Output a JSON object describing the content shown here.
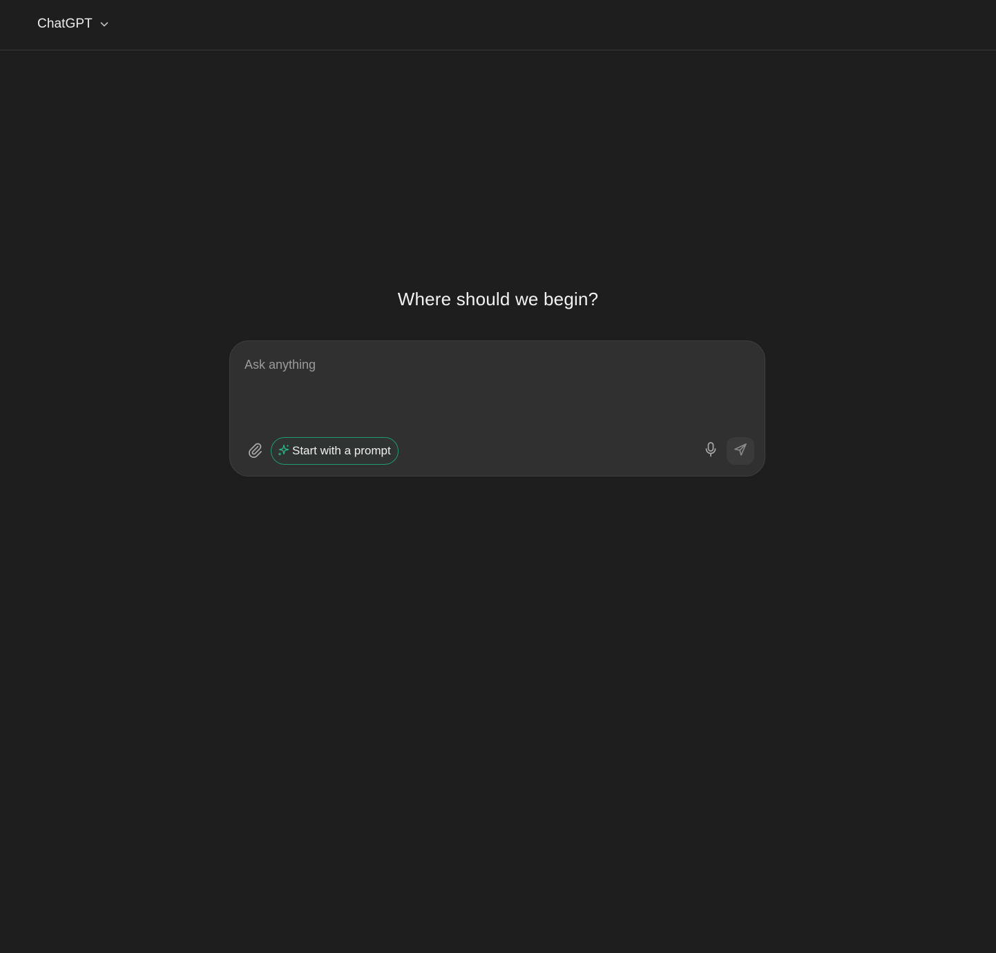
{
  "header": {
    "model_name": "ChatGPT",
    "dropdown_icon": "chevron-down-icon"
  },
  "main": {
    "headline": "Where should we begin?"
  },
  "composer": {
    "placeholder": "Ask anything",
    "value": "",
    "attach_icon": "paperclip-icon",
    "prompt_chip": {
      "label": "Start with a prompt",
      "icon": "sparkle-icon"
    },
    "mic_icon": "microphone-icon",
    "send_icon": "send-icon"
  },
  "colors": {
    "background": "#1e1e1e",
    "composer_background": "#303030",
    "accent": "#1f9d73",
    "text": "#ececec",
    "placeholder": "#9b9b9b"
  }
}
